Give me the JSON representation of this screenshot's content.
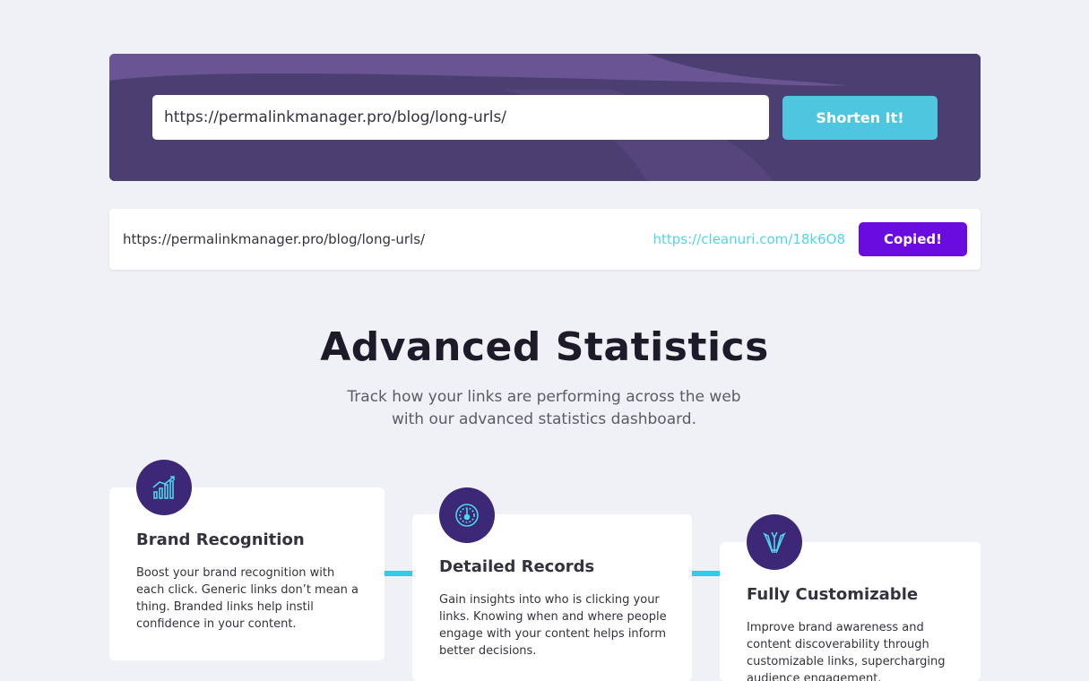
{
  "shorten": {
    "input_value": "https://permalinkmanager.pro/blog/long-urls/",
    "button_label": "Shorten It!"
  },
  "result": {
    "original_url": "https://permalinkmanager.pro/blog/long-urls/",
    "short_url": "https://cleanuri.com/18k6O8",
    "copy_label": "Copied!"
  },
  "stats": {
    "title": "Advanced Statistics",
    "subtitle_line1": "Track how your links are performing across the web",
    "subtitle_line2": "with our advanced statistics dashboard."
  },
  "features": [
    {
      "icon": "bar-chart-icon",
      "title": "Brand Recognition",
      "text": "Boost your brand recognition with each click. Generic links don’t mean a thing. Branded links help instil confidence in your content."
    },
    {
      "icon": "gauge-icon",
      "title": "Detailed Records",
      "text": "Gain insights into who is clicking your links. Knowing when and where people engage with your content helps inform better decisions."
    },
    {
      "icon": "pens-icon",
      "title": "Fully Customizable",
      "text": "Improve brand awareness and content discoverability through customizable links, supercharging audience engagement."
    }
  ],
  "colors": {
    "banner_bg": "#4b3f72",
    "banner_shape": "#6a5494",
    "accent_cyan": "#4fc6e0",
    "copied_purple": "#6a0be0",
    "icon_circle": "#3c2876"
  }
}
